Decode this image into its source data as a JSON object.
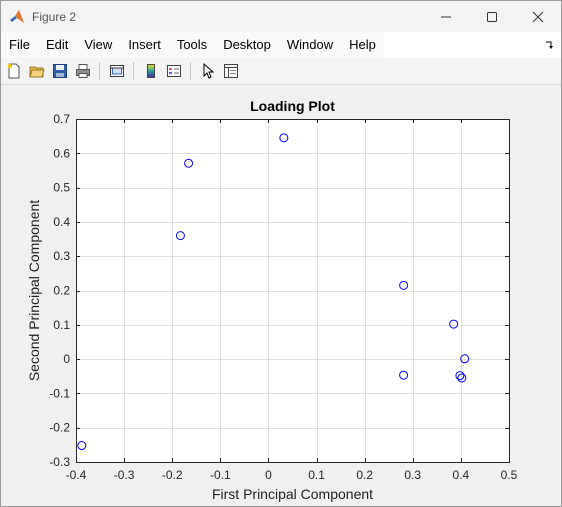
{
  "window": {
    "title": "Figure 2"
  },
  "menu": {
    "items": [
      {
        "label": "File"
      },
      {
        "label": "Edit"
      },
      {
        "label": "View"
      },
      {
        "label": "Insert"
      },
      {
        "label": "Tools"
      },
      {
        "label": "Desktop"
      },
      {
        "label": "Window"
      },
      {
        "label": "Help"
      }
    ]
  },
  "toolbar": {
    "buttons": [
      {
        "icon": "new-figure-icon"
      },
      {
        "icon": "open-file-icon"
      },
      {
        "icon": "save-icon"
      },
      {
        "icon": "print-icon"
      },
      {
        "icon": "link-plot-icon"
      },
      {
        "icon": "insert-colorbar-icon"
      },
      {
        "icon": "insert-legend-icon"
      },
      {
        "icon": "edit-plot-arrow-icon"
      },
      {
        "icon": "property-inspector-icon"
      }
    ]
  },
  "colors": {
    "marker": "#0000ff",
    "grid": "#dfdfdf",
    "axes_bg": "#ffffff",
    "figure_bg": "#f0f0f0"
  },
  "chart_data": {
    "type": "scatter",
    "title": "Loading Plot",
    "xlabel": "First Principal Component",
    "ylabel": "Second Principal Component",
    "xlim": [
      -0.4,
      0.5
    ],
    "ylim": [
      -0.3,
      0.7
    ],
    "xticks": [
      -0.4,
      -0.3,
      -0.2,
      -0.1,
      0,
      0.1,
      0.2,
      0.3,
      0.4,
      0.5
    ],
    "xtick_labels": [
      "-0.4",
      "-0.3",
      "-0.2",
      "-0.1",
      "0",
      "0.1",
      "0.2",
      "0.3",
      "0.4",
      "0.5"
    ],
    "yticks": [
      -0.3,
      -0.2,
      -0.1,
      0,
      0.1,
      0.2,
      0.3,
      0.4,
      0.5,
      0.6,
      0.7
    ],
    "ytick_labels": [
      "-0.3",
      "-0.2",
      "-0.1",
      "0",
      "0.1",
      "0.2",
      "0.3",
      "0.4",
      "0.5",
      "0.6",
      "0.7"
    ],
    "grid": true,
    "marker": "circle-open",
    "points": [
      {
        "x": -0.388,
        "y": -0.252
      },
      {
        "x": -0.183,
        "y": 0.36
      },
      {
        "x": -0.166,
        "y": 0.571
      },
      {
        "x": 0.032,
        "y": 0.645
      },
      {
        "x": 0.281,
        "y": 0.215
      },
      {
        "x": 0.281,
        "y": -0.047
      },
      {
        "x": 0.385,
        "y": 0.102
      },
      {
        "x": 0.398,
        "y": -0.048
      },
      {
        "x": 0.402,
        "y": -0.055
      },
      {
        "x": 0.408,
        "y": 0.001
      }
    ]
  }
}
